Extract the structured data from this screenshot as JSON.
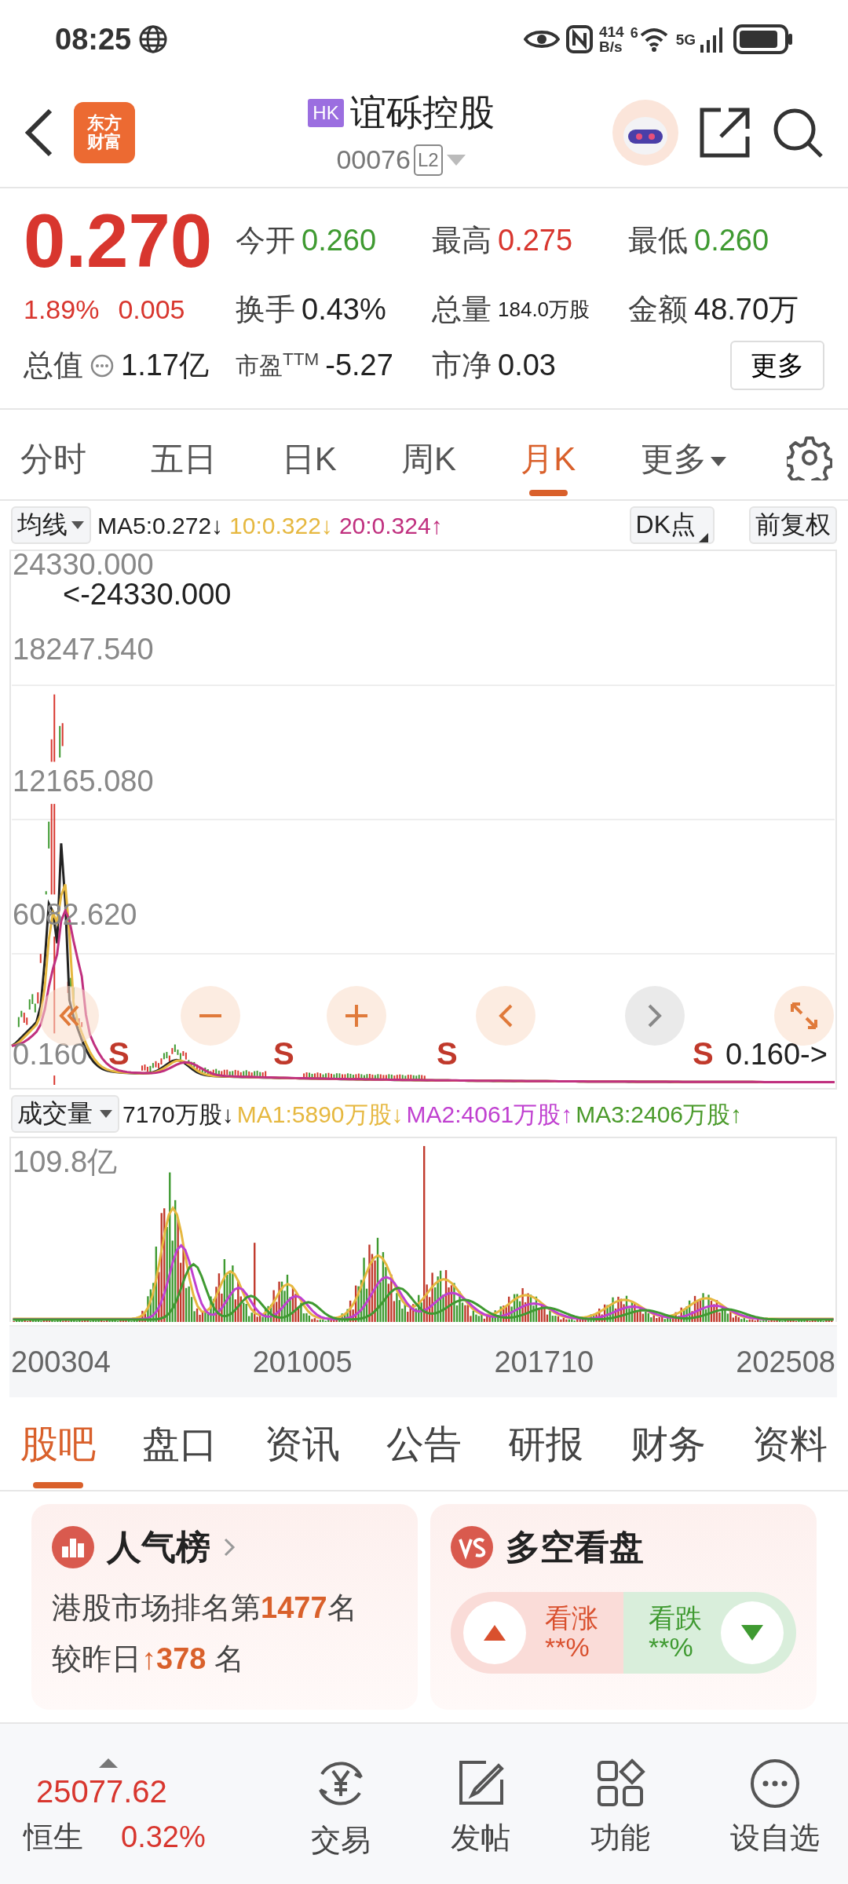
{
  "status_bar": {
    "time": "08:25",
    "speed_value": "414",
    "speed_unit": "B/s",
    "wifi_label": "6",
    "network": "5G"
  },
  "header": {
    "logo_lines": [
      "东方",
      "财富"
    ],
    "market_badge": "HK",
    "title": "谊砾控股",
    "code": "00076",
    "level_badge": "L2"
  },
  "quote": {
    "price": "0.270",
    "change_pct": "1.89%",
    "change": "0.005",
    "stats": [
      {
        "label": "今开",
        "value": "0.260",
        "color": "#3f9a31"
      },
      {
        "label": "最高",
        "value": "0.275",
        "color": "#d8362e"
      },
      {
        "label": "最低",
        "value": "0.260",
        "color": "#3f9a31"
      },
      {
        "label": "换手",
        "value": "0.43%",
        "color": "#222222"
      },
      {
        "label": "总量",
        "value": "184.0万股",
        "color": "#222222"
      },
      {
        "label": "金额",
        "value": "48.70万",
        "color": "#222222"
      },
      {
        "label": "总值",
        "value": "1.17亿",
        "color": "#222222"
      },
      {
        "label": "市盈$^{TTM}$",
        "value": "-5.27",
        "color": "#222222"
      },
      {
        "label": "市净",
        "value": "0.03",
        "color": "#222222"
      }
    ],
    "more_button": "更多"
  },
  "periods": [
    {
      "label": "分时",
      "selected": false
    },
    {
      "label": "五日",
      "selected": false
    },
    {
      "label": "日K",
      "selected": false
    },
    {
      "label": "周K",
      "selected": false
    },
    {
      "label": "月K",
      "selected": true
    },
    {
      "label": "更多",
      "selected": false
    }
  ],
  "indicator_bar": {
    "selector": "均线",
    "ma": [
      {
        "text": "MA5:0.272↓",
        "color": "#222222"
      },
      {
        "text": "10:0.322↓",
        "color": "#e6b840"
      },
      {
        "text": "20:0.324↑",
        "color": "#c0307f"
      }
    ],
    "dk_button": "DK点",
    "adjust_button": "前复权"
  },
  "price_chart": {
    "axis_labels": [
      "24330.000",
      "18247.540",
      "12165.080",
      "6082.620",
      "0.160"
    ],
    "max_marker": "<-24330.000",
    "min_marker": "0.160->",
    "signals": [
      "S",
      "S",
      "S",
      "S"
    ]
  },
  "volume_bar": {
    "selector": "成交量",
    "items": [
      {
        "text": "7170万股↓",
        "color": "#222222"
      },
      {
        "text": "MA1:5890万股↓",
        "color": "#e6b840"
      },
      {
        "text": "MA2:4061万股↑",
        "color": "#c040d0"
      },
      {
        "text": "MA3:2406万股↑",
        "color": "#4a9a2a"
      }
    ]
  },
  "volume_chart": {
    "max_label": "109.8亿",
    "dates": [
      "200304",
      "201005",
      "201710",
      "202508"
    ]
  },
  "sections": [
    {
      "label": "股吧",
      "selected": true
    },
    {
      "label": "盘口",
      "selected": false
    },
    {
      "label": "资讯",
      "selected": false
    },
    {
      "label": "公告",
      "selected": false
    },
    {
      "label": "研报",
      "selected": false
    },
    {
      "label": "财务",
      "selected": false
    },
    {
      "label": "资料",
      "selected": false
    }
  ],
  "popularity": {
    "title": "人气榜",
    "rank_text": "港股市场排名第**1477**名",
    "change_text": "较昨日**↑378** 名"
  },
  "sentiment": {
    "title": "多空看盘",
    "bull_label": "看涨",
    "bull_value": "**%",
    "bear_label": "看跌",
    "bear_value": "**%"
  },
  "bottom_nav": {
    "index_value": "25077.62",
    "index_name": "恒生",
    "index_change": "0.32%",
    "items": [
      "交易",
      "发帖",
      "功能",
      "设自选"
    ]
  }
}
